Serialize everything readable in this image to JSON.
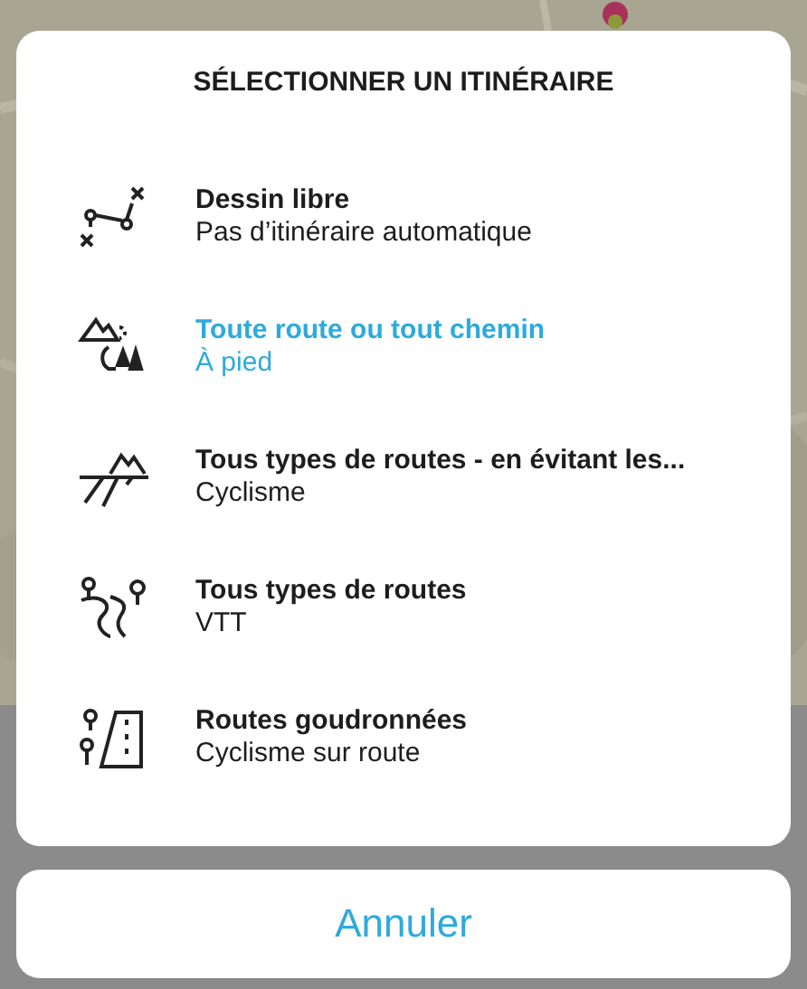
{
  "sheet": {
    "title": "SÉLECTIONNER UN ITINÉRAIRE",
    "options": [
      {
        "title": "Dessin libre",
        "subtitle": "Pas d’itinéraire automatique",
        "selected": false
      },
      {
        "title": "Toute route ou tout chemin",
        "subtitle": "À pied",
        "selected": true
      },
      {
        "title": "Tous types de routes - en évitant les...",
        "subtitle": "Cyclisme",
        "selected": false
      },
      {
        "title": "Tous types de routes",
        "subtitle": "VTT",
        "selected": false
      },
      {
        "title": "Routes goudronnées",
        "subtitle": "Cyclisme sur route",
        "selected": false
      }
    ]
  },
  "cancel_button": "Annuler"
}
